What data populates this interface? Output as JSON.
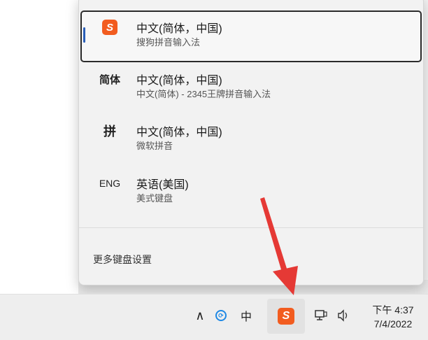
{
  "ime_menu": {
    "items": [
      {
        "icon": "sogou-icon",
        "icon_text": "S",
        "title": "中文(简体，中国)",
        "subtitle": "搜狗拼音输入法",
        "selected": true
      },
      {
        "icon_text": "简体",
        "title": "中文(简体，中国)",
        "subtitle": "中文(简体) - 2345王牌拼音输入法"
      },
      {
        "icon_text": "拼",
        "title": "中文(简体，中国)",
        "subtitle": "微软拼音"
      },
      {
        "icon_text": "ENG",
        "title": "英语(美国)",
        "subtitle": "美式键盘"
      }
    ],
    "settings_label": "更多键盘设置"
  },
  "taskbar": {
    "chevron": "∧",
    "ime_mode": "中",
    "time": "下午 4:37",
    "date": "7/4/2022"
  },
  "colors": {
    "accent": "#2a5fb8",
    "sogou_brand": "#f25c1f",
    "arrow": "#e53935"
  }
}
